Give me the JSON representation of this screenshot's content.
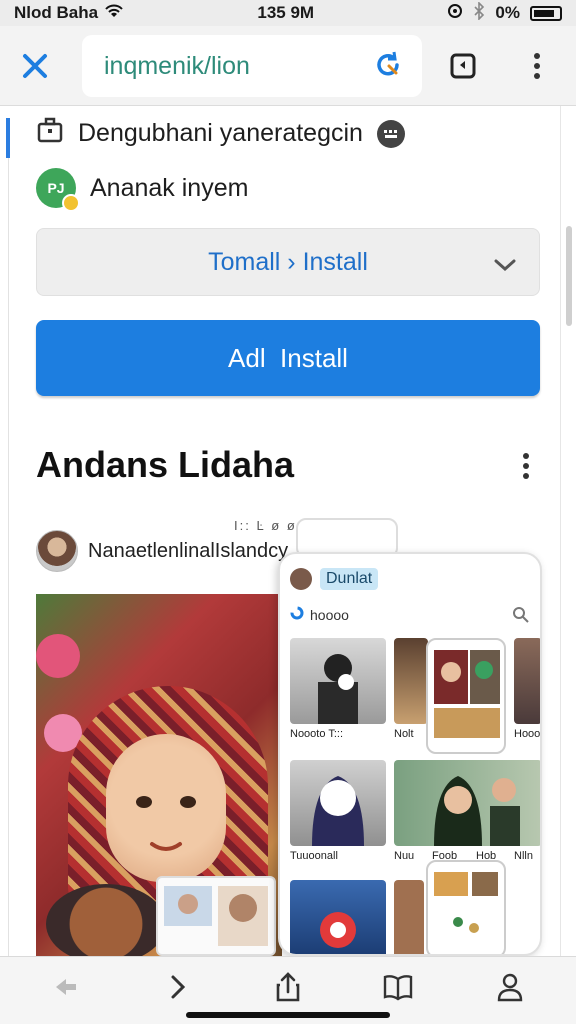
{
  "status_bar": {
    "carrier": "Nlod Baha",
    "time": "135 9M",
    "battery_pct": "0%"
  },
  "toolbar": {
    "url": "inqmenik/lion"
  },
  "app_info": {
    "developer": "Dengubhani yanerategcin",
    "name": "Ananak inyem",
    "avatar_text": "PJ"
  },
  "install": {
    "dropdown_label": "Tomall › Install",
    "button_label": "Adl  Install"
  },
  "section": {
    "title": "Andans Lidaha"
  },
  "card": {
    "username": "NanaetlenlinalIslandcy",
    "tiny_meta": "I:: Ŀ ø ø",
    "mock_title": "Dunlat",
    "mock_search": "hoooo",
    "captions": [
      "Noooto T:::",
      "Nolt",
      "Hooo",
      "Tuuoonall",
      "Nuu",
      "Foob",
      "Hob",
      "Nlln"
    ]
  },
  "colors": {
    "accent": "#1d7ee0",
    "link": "#1f6fc9",
    "url_text": "#2e8b7a"
  }
}
